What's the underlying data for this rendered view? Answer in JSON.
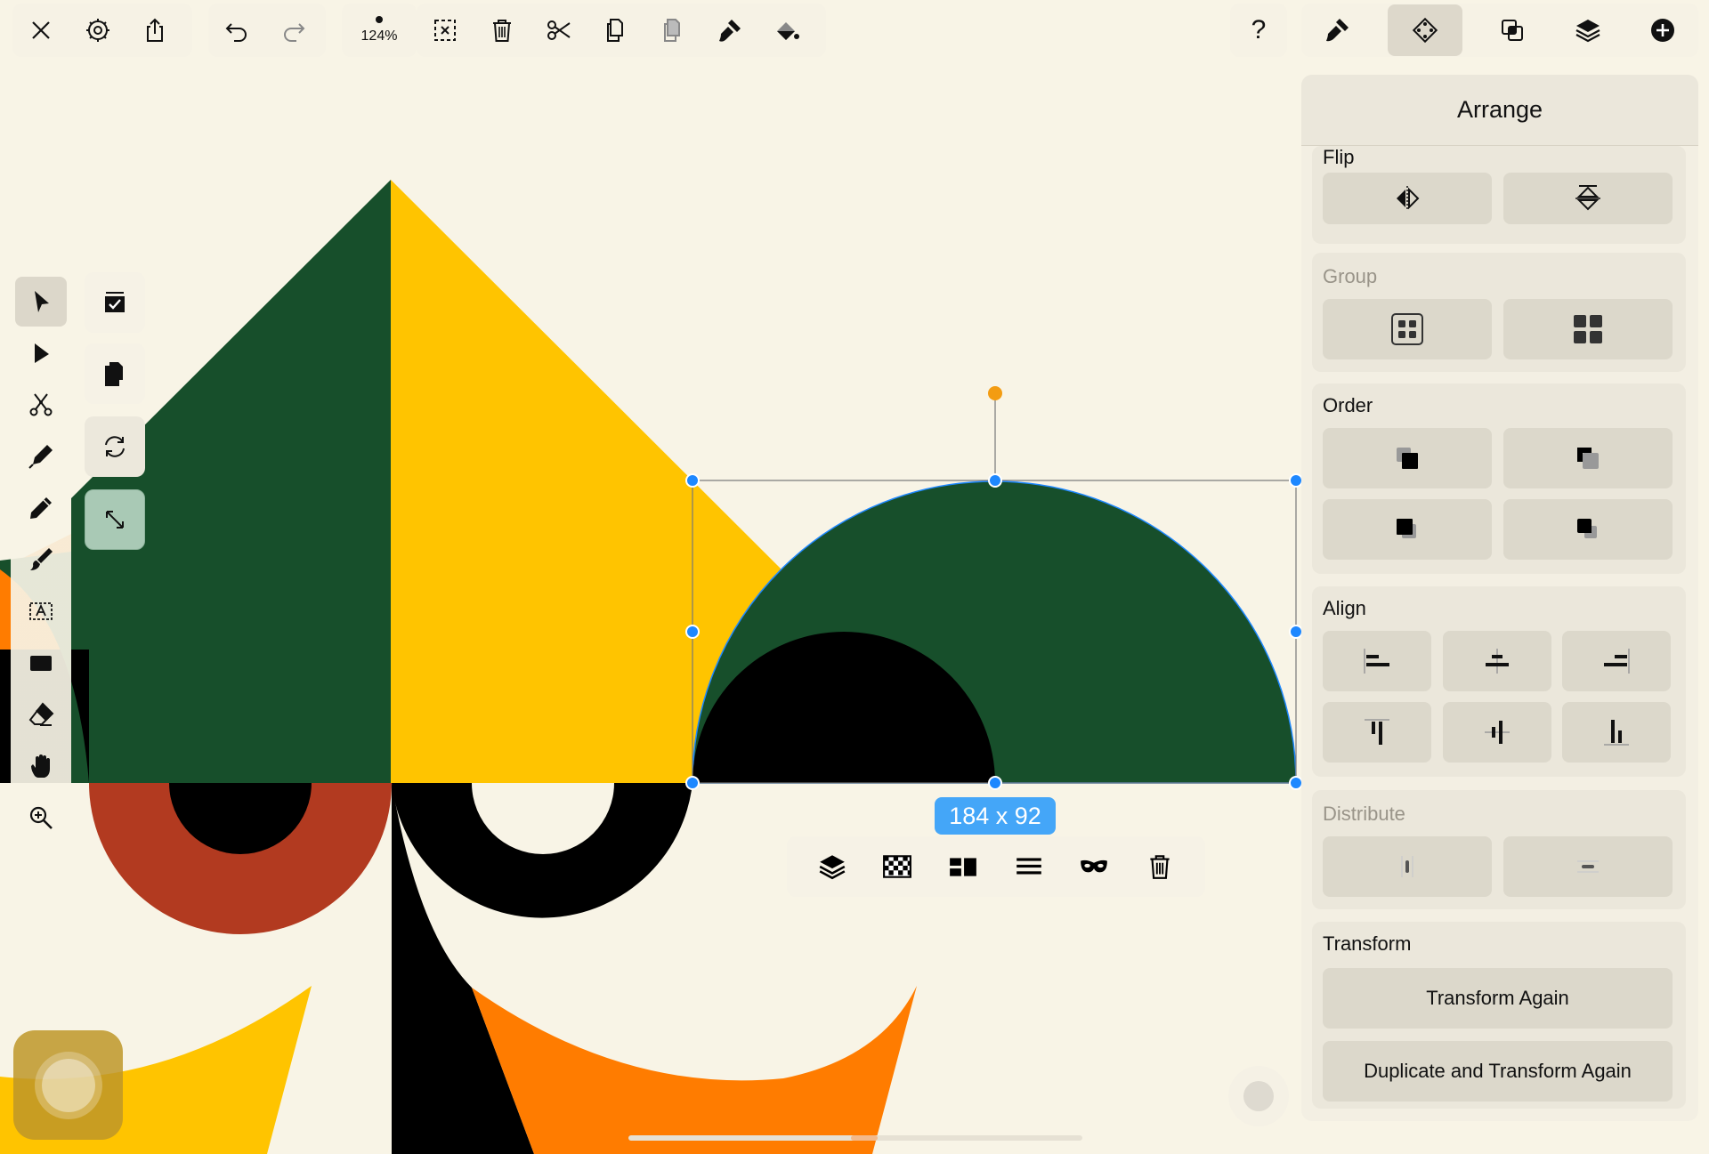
{
  "toolbar": {
    "zoom_label": "124%",
    "help_label": "?"
  },
  "panel": {
    "title": "Arrange",
    "flip": {
      "title": "Flip"
    },
    "group": {
      "title": "Group"
    },
    "order": {
      "title": "Order"
    },
    "align": {
      "title": "Align"
    },
    "distribute": {
      "title": "Distribute"
    },
    "transform": {
      "title": "Transform",
      "transform_again_label": "Transform Again",
      "duplicate_transform_label": "Duplicate and Transform Again"
    }
  },
  "selection": {
    "size_label": "184 x 92"
  },
  "colors": {
    "background": "#f8f4e6",
    "dark_green": "#174f2b",
    "yellow": "#ffc400",
    "orange": "#ff7c00",
    "rust": "#b23a20",
    "black": "#000000",
    "selection_blue": "#1e88ff",
    "rotate_handle": "#f39c12"
  },
  "icons": {
    "top_left": [
      "close-icon",
      "settings-icon",
      "share-icon"
    ],
    "history": [
      "undo-icon",
      "redo-icon"
    ],
    "edit": [
      "deselect-icon",
      "trash-icon",
      "scissors-icon",
      "copy-icon",
      "paste-icon",
      "format-brush-icon",
      "paint-bucket-icon"
    ],
    "inspectors": [
      "style-icon",
      "arrange-icon",
      "path-ops-icon",
      "layers-icon",
      "add-icon"
    ],
    "tools": [
      "select-icon",
      "direct-select-icon",
      "scissors-tool-icon",
      "pen-icon",
      "pencil-icon",
      "brush-icon",
      "text-icon",
      "rectangle-icon",
      "eraser-icon",
      "hand-icon",
      "zoom-icon"
    ]
  }
}
